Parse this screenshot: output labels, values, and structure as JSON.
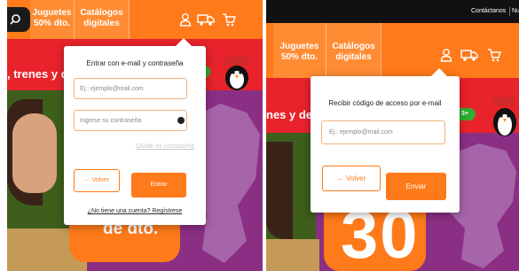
{
  "left_screen": {
    "nav": {
      "tab_toys": "Juguetes\n50% dto.",
      "tab_catalogs": "Catálogos\ndigitales"
    },
    "hero": {
      "headline_fragment": ", trenes y d",
      "promo_text": "de dto."
    },
    "login_popup": {
      "title": "Entrar con e-mail y contraseña",
      "email_placeholder": "Ej.: ejemplo@mail.com",
      "password_placeholder": "Ingrese su contraseña",
      "forgot_link": "Olvidé mi contraseña",
      "back_button": "← Volver",
      "submit_button": "Entrar",
      "register_link": "¿No tiene una cuenta? Regístrese"
    },
    "icons": [
      "search-icon",
      "user-icon",
      "truck-icon",
      "cart-icon",
      "eye-icon"
    ]
  },
  "right_screen": {
    "topbar": {
      "contact_link": "Contáctanos",
      "next_link_fragment": "Nu"
    },
    "nav": {
      "tab_toys": "Juguetes\n50% dto.",
      "tab_catalogs": "Catálogos\ndigitales"
    },
    "hero": {
      "headline_fragment": "nes y de",
      "promo_number": "30"
    },
    "code_popup": {
      "title": "Recibir código de acceso por e-mail",
      "email_placeholder": "Ej.: ejemplo@mail.com",
      "back_button": "← Volver",
      "submit_button": "Enviar"
    },
    "icons": [
      "user-icon",
      "truck-icon",
      "cart-icon"
    ]
  },
  "colors": {
    "brand_orange": "#ff7a1a",
    "hero_red": "#e8232b",
    "hero_purple": "#8b2f84",
    "input_border": "#f0b27a",
    "topbar_black": "#111111"
  }
}
